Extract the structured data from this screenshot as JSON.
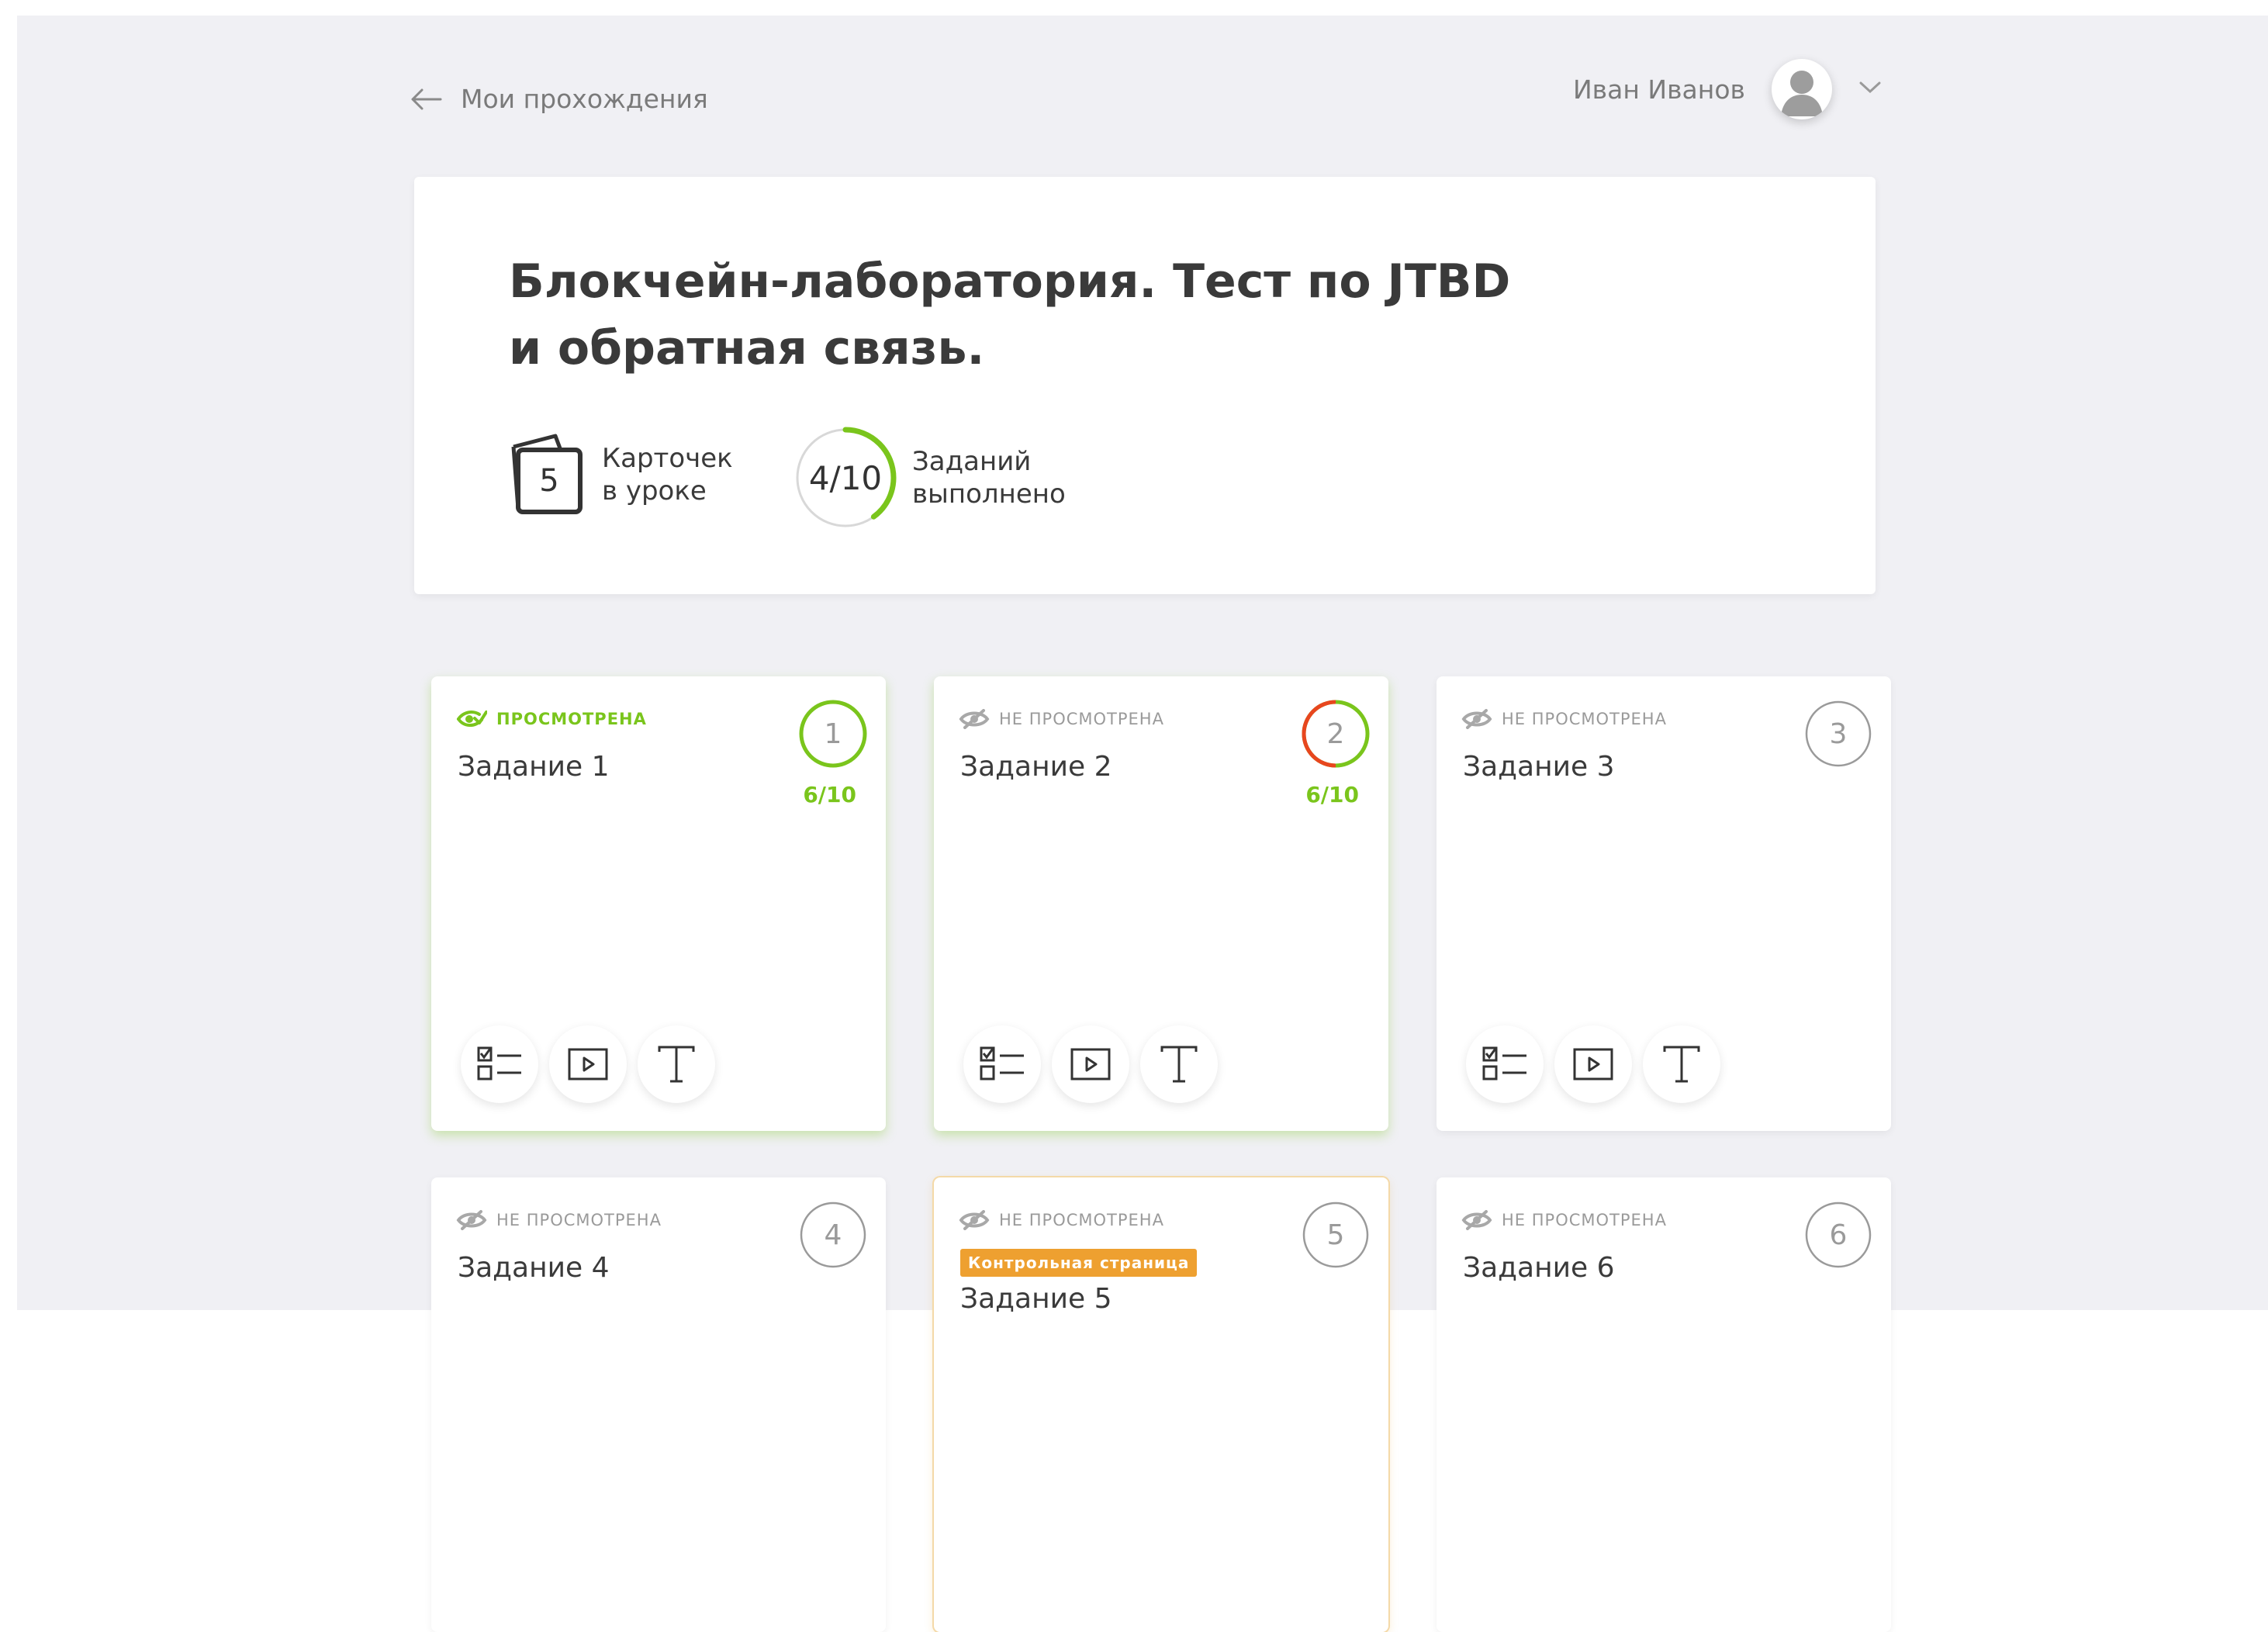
{
  "nav": {
    "back_label": "Мои прохождения"
  },
  "user": {
    "name": "Иван Иванов"
  },
  "lesson": {
    "title_line1": "Блокчейн-лаборатория. Тест по JTBD",
    "title_line2": "и обратная связь.",
    "cards_count": "5",
    "cards_label_1": "Карточек",
    "cards_label_2": "в уроке",
    "tasks_progress_text": "4/10",
    "tasks_done_fraction": 0.4,
    "tasks_label_1": "Заданий",
    "tasks_label_2": "выполнено"
  },
  "colors": {
    "accent_green": "#7ac51c",
    "accent_red": "#e8461e",
    "badge_orange": "#eea030",
    "background": "#f0f0f4"
  },
  "tasks": [
    {
      "status": "Просмотрена",
      "title": "Задание 1",
      "number": "1",
      "score": "6/10",
      "ring": "green"
    },
    {
      "status": "Не просмотрена",
      "title": "Задание 2",
      "number": "2",
      "score": "6/10",
      "ring": "red-green"
    },
    {
      "status": "Не просмотрена",
      "title": "Задание 3",
      "number": "3"
    },
    {
      "status": "Не просмотрена",
      "title": "Задание 4",
      "number": "4"
    },
    {
      "status": "Не просмотрена",
      "title": "Задание 5",
      "number": "5",
      "badge": "Контрольная страница"
    },
    {
      "status": "Не просмотрена",
      "title": "Задание 6",
      "number": "6"
    }
  ],
  "icons": {
    "back": "arrow-left-icon",
    "chevron": "chevron-down-icon",
    "eye_seen": "eye-check-icon",
    "eye_unseen": "eye-slash-icon",
    "tools": [
      "checklist-icon",
      "video-icon",
      "text-icon"
    ]
  }
}
